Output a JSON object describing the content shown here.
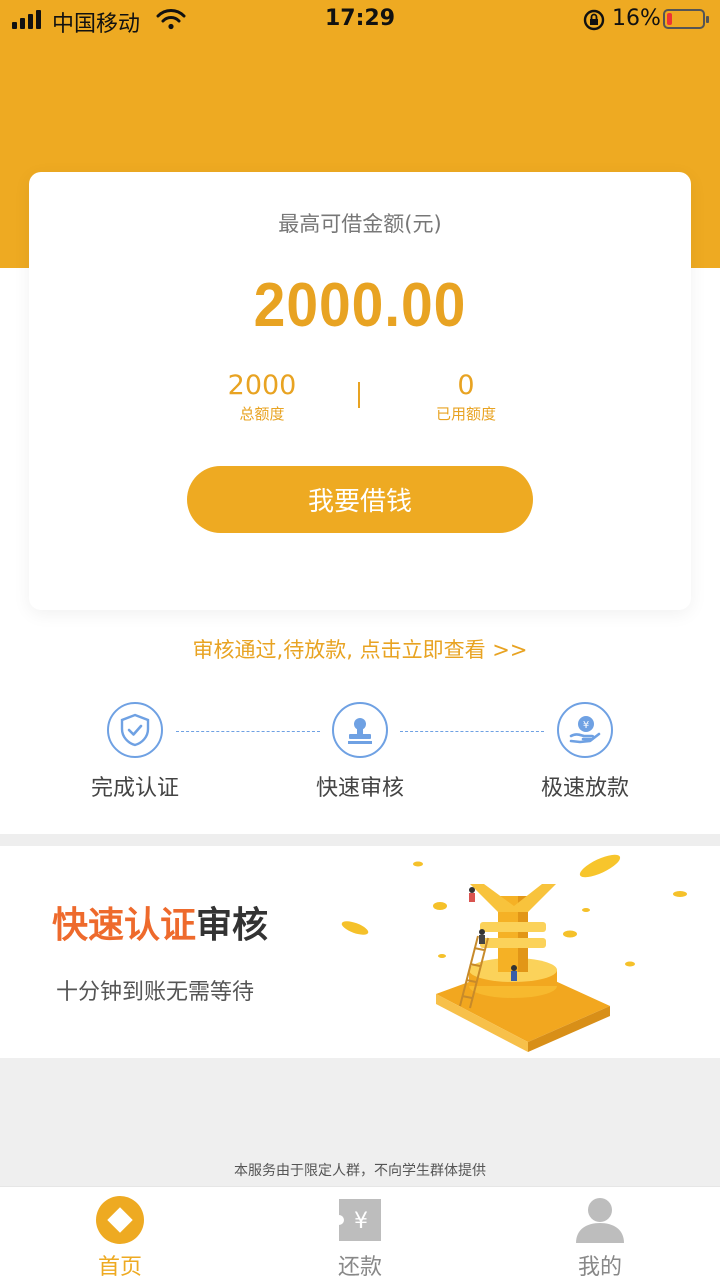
{
  "status_bar": {
    "carrier": "中国移动",
    "time": "17:29",
    "battery_percent": "16%",
    "battery_level": 0.16
  },
  "card": {
    "label": "最高可借金额(元)",
    "amount": "2000.00",
    "total_value": "2000",
    "total_label": "总额度",
    "used_value": "0",
    "used_label": "已用额度",
    "borrow_button": "我要借钱"
  },
  "notice": "审核通过,待放款, 点击立即查看  >>",
  "steps": [
    {
      "label": "完成认证",
      "icon": "shield-check-icon"
    },
    {
      "label": "快速审核",
      "icon": "stamp-icon"
    },
    {
      "label": "极速放款",
      "icon": "hand-yen-icon"
    }
  ],
  "banner": {
    "title_accent": "快速认证",
    "title_rest": "审核",
    "subtitle": "十分钟到账无需等待"
  },
  "disclaimer": "本服务由于限定人群，不向学生群体提供",
  "tabs": [
    {
      "label": "首页",
      "icon": "home-diamond-icon",
      "active": true
    },
    {
      "label": "还款",
      "icon": "yen-ticket-icon",
      "active": false
    },
    {
      "label": "我的",
      "icon": "user-icon",
      "active": false
    }
  ],
  "colors": {
    "brand": "#eeaa22",
    "accent_orange": "#ee6a2c",
    "step_blue": "#6fa1e3"
  }
}
